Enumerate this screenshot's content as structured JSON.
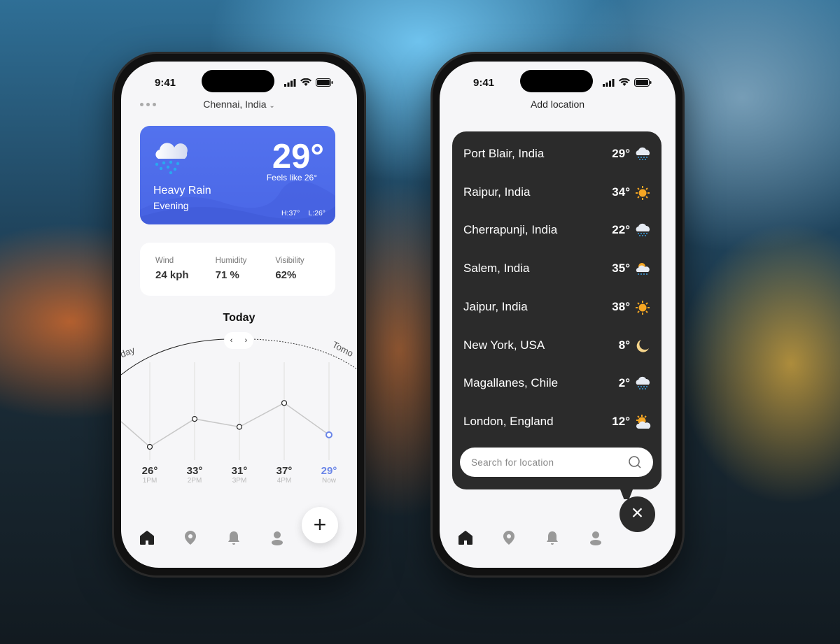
{
  "status": {
    "time": "9:41"
  },
  "home": {
    "location": "Chennai, India",
    "current": {
      "temp": "29°",
      "feels_like": "Feels like 26°",
      "condition": "Heavy Rain",
      "period": "Evening",
      "high": "H:37°",
      "low": "L:26°",
      "icon": "cloud-rain-icon"
    },
    "stats": [
      {
        "label": "Wind",
        "value": "24 kph"
      },
      {
        "label": "Humidity",
        "value": "71 %"
      },
      {
        "label": "Visibility",
        "value": "62%"
      }
    ],
    "day_title": "Today",
    "prev_day": "rday",
    "next_day": "Tomo",
    "chart_data": {
      "type": "line",
      "categories": [
        "1PM",
        "2PM",
        "3PM",
        "4PM",
        "Now"
      ],
      "values": [
        26,
        33,
        31,
        37,
        29
      ],
      "labels": [
        "26°",
        "33°",
        "31°",
        "37°",
        "29°"
      ],
      "highlight_color": "#6b86e8"
    },
    "nav": [
      "home-icon",
      "location-icon",
      "bell-icon",
      "user-icon"
    ],
    "fab": "+"
  },
  "add": {
    "title": "Add location",
    "locations": [
      {
        "name": "Port Blair, India",
        "temp": "29°",
        "icon": "rain-cloud"
      },
      {
        "name": "Raipur, India",
        "temp": "34°",
        "icon": "sun"
      },
      {
        "name": "Cherrapunji, India",
        "temp": "22°",
        "icon": "rain-cloud"
      },
      {
        "name": "Salem, India",
        "temp": "35°",
        "icon": "sun-cloud-rain"
      },
      {
        "name": "Jaipur, India",
        "temp": "38°",
        "icon": "sun"
      },
      {
        "name": "New York, USA",
        "temp": "8°",
        "icon": "moon"
      },
      {
        "name": "Magallanes, Chile",
        "temp": "2°",
        "icon": "rain-cloud"
      },
      {
        "name": "London, England",
        "temp": "12°",
        "icon": "sun-cloud"
      }
    ],
    "search_placeholder": "Search for location",
    "close": "×"
  },
  "colors": {
    "accent": "#5372ee",
    "dark_panel": "#2b2b2b"
  }
}
